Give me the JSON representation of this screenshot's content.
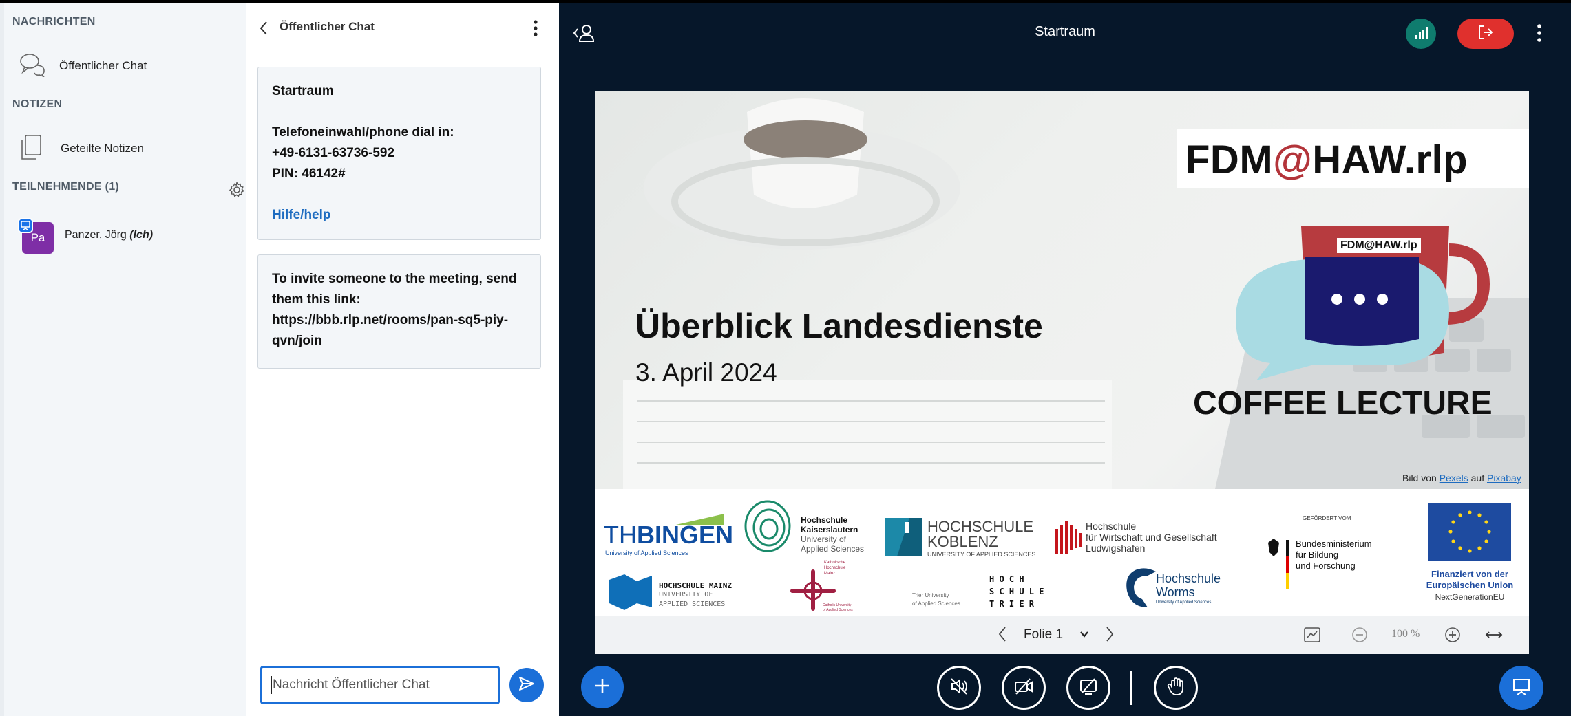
{
  "sidebar": {
    "messages_header": "NACHRICHTEN",
    "public_chat_label": "Öffentlicher Chat",
    "notes_header": "NOTIZEN",
    "shared_notes_label": "Geteilte Notizen",
    "participants_header": "TEILNEHMENDE (1)",
    "users": [
      {
        "initials": "Pa",
        "name": "Panzer, Jörg",
        "self_tag": "(Ich)",
        "avatar_color": "#7e2ea6"
      }
    ]
  },
  "chat": {
    "title": "Öffentlicher Chat",
    "welcome": {
      "room": "Startraum",
      "dial_label": "Telefoneinwahl/phone dial in:",
      "phone": "+49-6131-63736-592",
      "pin": "PIN: 46142#",
      "help": "Hilfe/help"
    },
    "invite_line1": "To invite someone to the meeting, send",
    "invite_line2": "them this link:",
    "invite_line3": "https://bbb.rlp.net/rooms/pan-sq5-piy-",
    "invite_line4": "qvn/join",
    "input_placeholder": "Nachricht Öffentlicher Chat"
  },
  "stage": {
    "room_title": "Startraum",
    "slide": {
      "fdm_prefix": "FDM",
      "fdm_at": "@",
      "fdm_suffix": "HAW.rlp",
      "mug_label": "FDM@HAW.rlp",
      "title": "Überblick Landesdienste",
      "date": "3. April 2024",
      "series": "COFFEE LECTURE",
      "credit_prefix": "Bild von",
      "credit_link1": "Pexels",
      "credit_mid": "auf",
      "credit_link2": "Pixabay"
    },
    "logos": {
      "th": "TH",
      "bingen": "BINGEN",
      "th_sub": "University of Applied Sciences",
      "kl1": "Hochschule",
      "kl2": "Kaiserslautern",
      "kl3": "University of",
      "kl4": "Applied Sciences",
      "ko1": "HOCHSCHULE",
      "ko2": "KOBLENZ",
      "ko3": "UNIVERSITY OF APPLIED SCIENCES",
      "lu1": "Hochschule",
      "lu2": "für Wirtschaft und Gesellschaft",
      "lu3": "Ludwigshafen",
      "bm0": "GEFÖRDERT VOM",
      "bm1": "Bundesministerium",
      "bm2": "für Bildung",
      "bm3": "und Forschung",
      "eu1": "Finanziert von der",
      "eu2": "Europäischen Union",
      "eu3": "NextGenerationEU",
      "mz1": "HOCHSCHULE MAINZ",
      "mz2": "UNIVERSITY OF",
      "mz3": "APPLIED SCIENCES",
      "kh1": "Katholische",
      "kh2": "Hochschule",
      "kh3": "Mainz",
      "kh4": "Catholic University",
      "kh5": "of Applied Sciences",
      "tr0": "Trier University",
      "tr00": "of Applied Sciences",
      "tr1": "H   O   C   H",
      "tr2": "S  C   H   U  L  E",
      "tr3": "T  R   I  E  R",
      "wo1": "Hochschule",
      "wo2": "Worms",
      "wo3": "University of Applied Sciences"
    },
    "slide_nav": {
      "current": "Folie 1",
      "zoom": "100 %"
    }
  },
  "colors": {
    "accent": "#1b6fd8",
    "leave": "#e0302d",
    "connection": "#0f7c6e",
    "stage_bg": "#06172a"
  },
  "icons": [
    "chat-bubbles-icon",
    "notes-icon",
    "gear-icon",
    "presenter-icon",
    "back-chevron-icon",
    "kebab-icon",
    "send-icon",
    "user-list-icon",
    "signal-icon",
    "leave-icon",
    "plus-icon",
    "muted-speaker-icon",
    "camera-off-icon",
    "screenshare-off-icon",
    "raise-hand-icon",
    "presentation-icon",
    "prev-icon",
    "next-icon",
    "chevron-down-icon",
    "whiteboard-icon",
    "zoom-out-icon",
    "zoom-in-icon",
    "fit-width-icon"
  ]
}
